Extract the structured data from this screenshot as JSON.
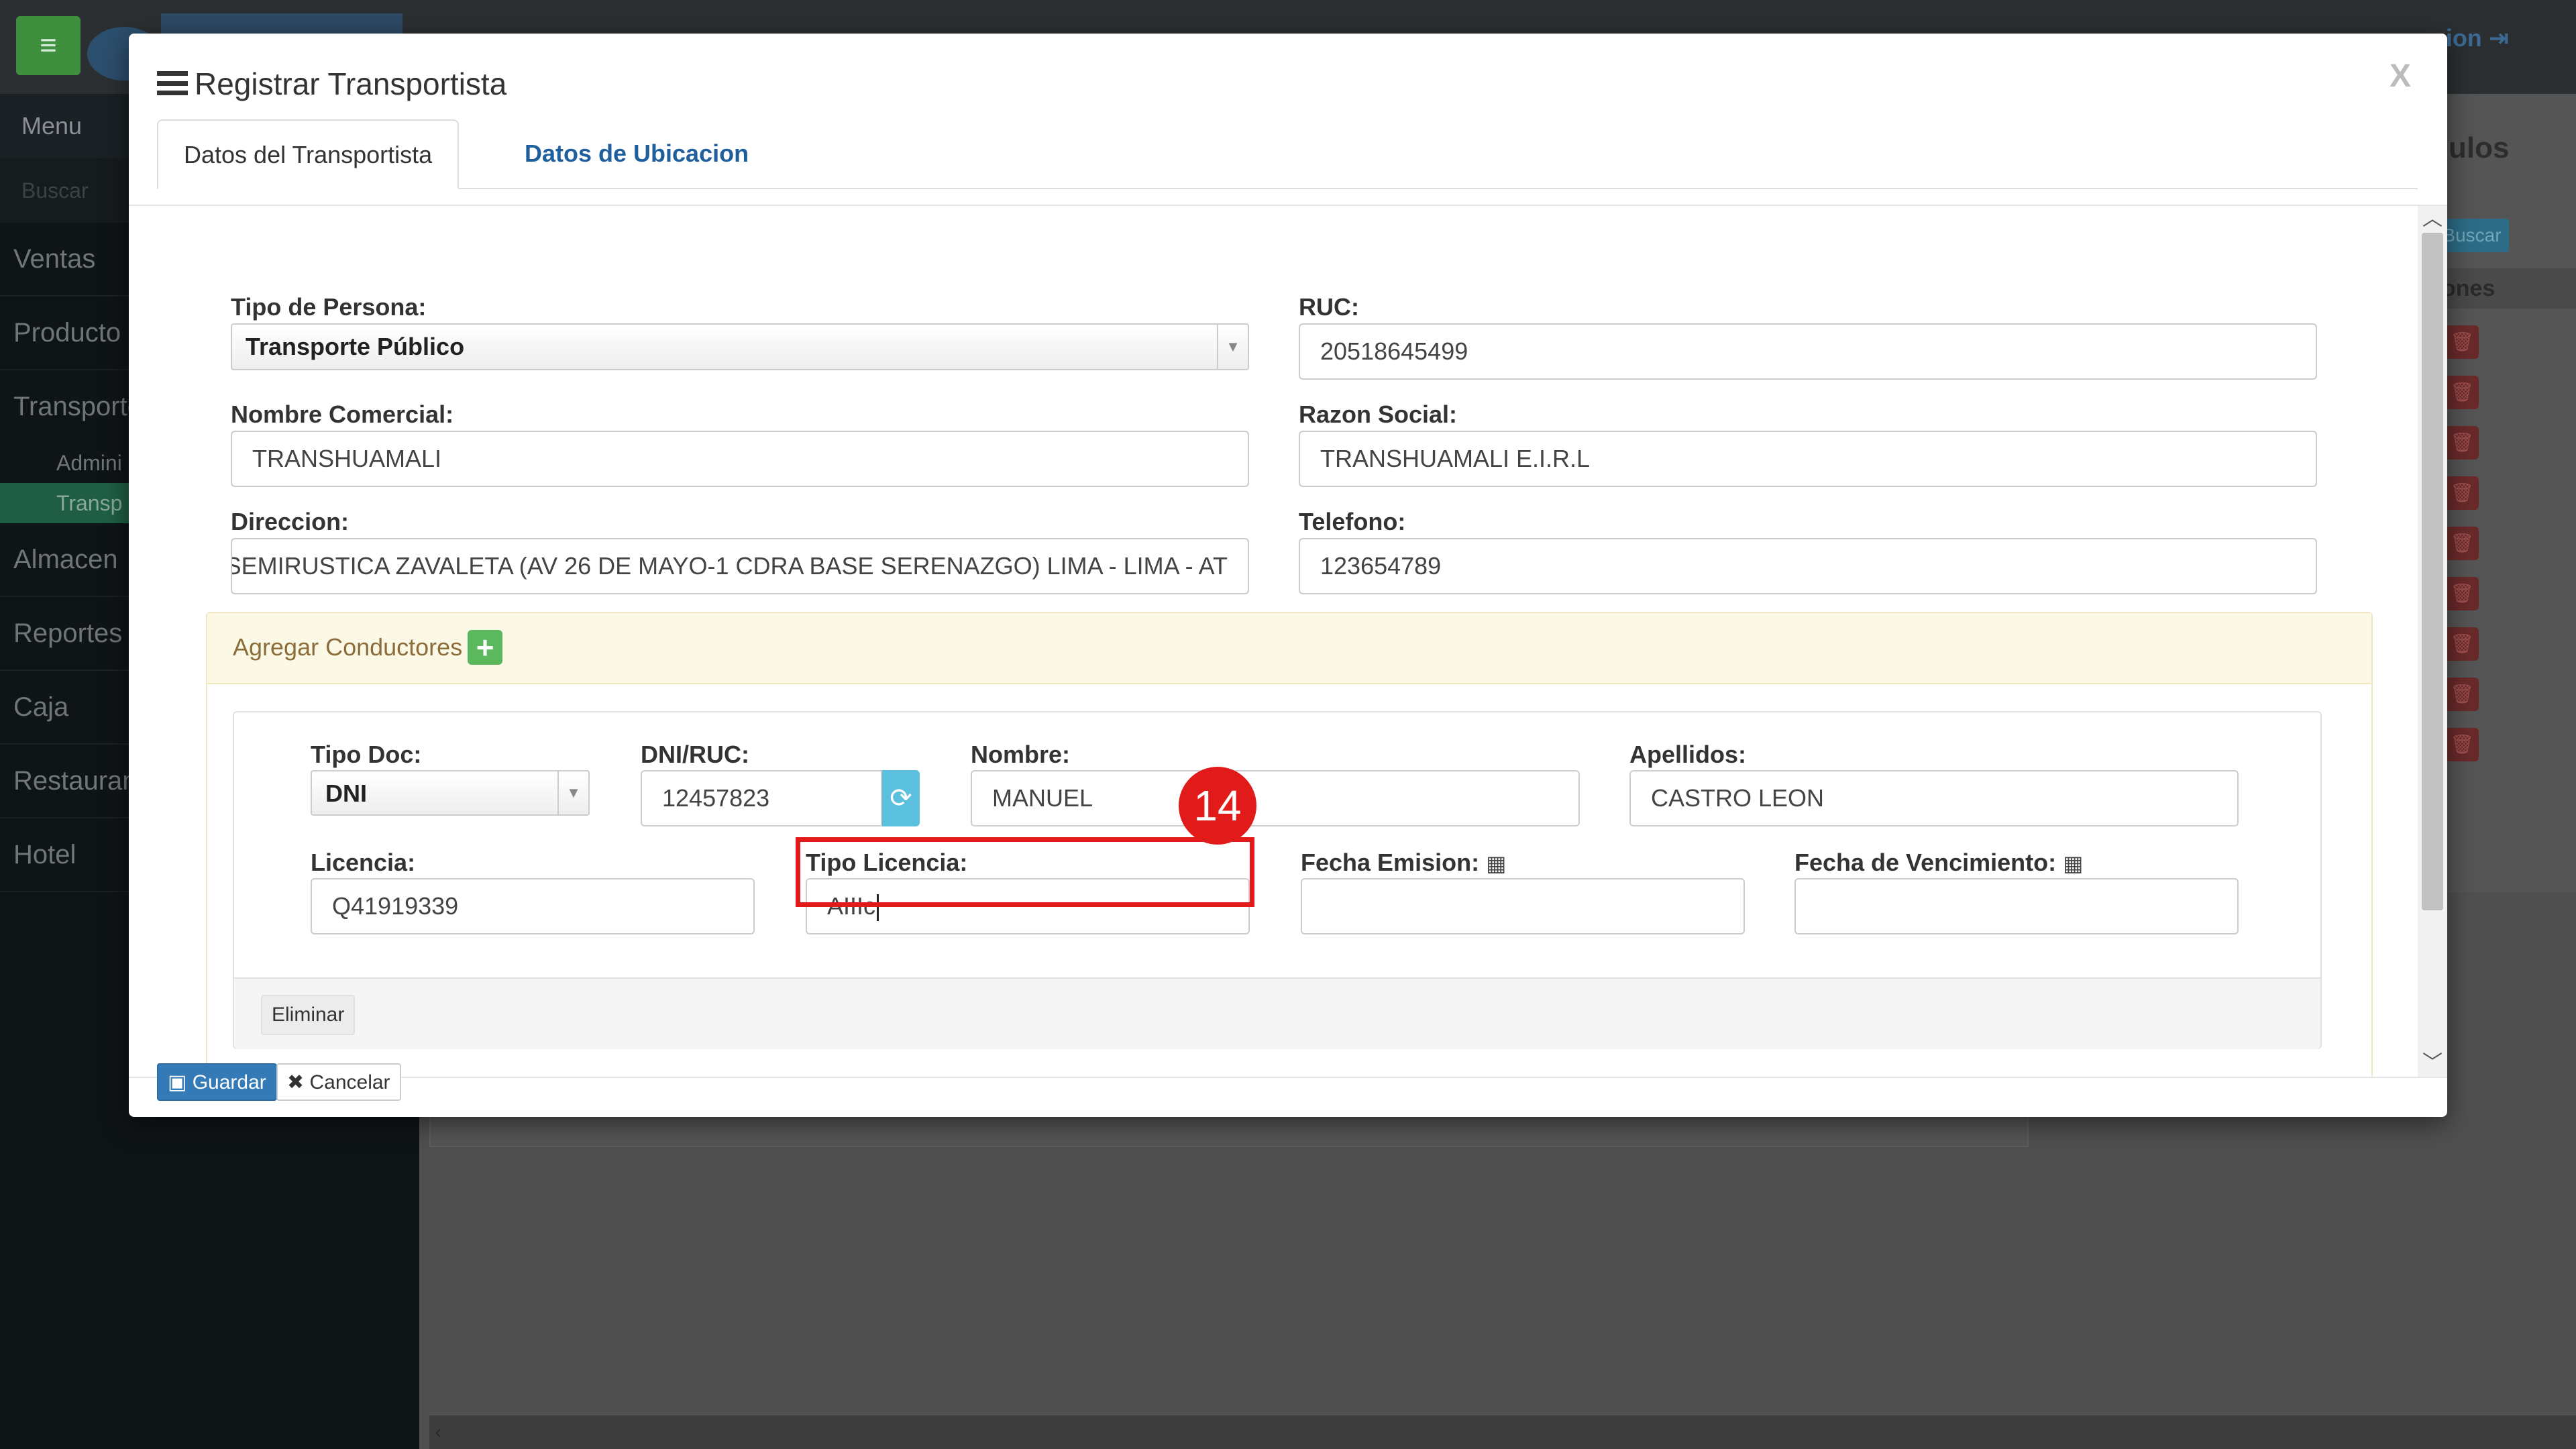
{
  "background": {
    "topbar_right": "sion",
    "sidebar": {
      "menu_label": "Menu",
      "search_placeholder": "Buscar",
      "items": [
        "Ventas",
        "Producto",
        "Transporte",
        "Almacen",
        "Reportes",
        "Caja",
        "Restaurant",
        "Hotel"
      ],
      "sub_items": [
        "Admini",
        "Transp"
      ]
    },
    "right_title": "ulos",
    "right_button": "Buscar",
    "right_header": "ones"
  },
  "modal": {
    "title": "Registrar Transportista",
    "close_label": "X",
    "tabs": [
      {
        "label": "Datos del Transportista",
        "active": true
      },
      {
        "label": "Datos de Ubicacion",
        "active": false
      }
    ],
    "fields": {
      "tipo_persona": {
        "label": "Tipo de Persona:",
        "value": "Transporte Público"
      },
      "ruc": {
        "label": "RUC:",
        "value": "20518645499"
      },
      "nombre_comercial": {
        "label": "Nombre Comercial:",
        "value": "TRANSHUAMALI"
      },
      "razon_social": {
        "label": "Razon Social:",
        "value": "TRANSHUAMALI E.I.R.L"
      },
      "direccion": {
        "label": "Direccion:",
        "value": "SEMIRUSTICA ZAVALETA (AV 26 DE MAYO-1 CDRA BASE SERENAZGO) LIMA - LIMA - AT"
      },
      "telefono": {
        "label": "Telefono:",
        "value": "123654789"
      }
    },
    "conductores": {
      "title": "Agregar Conductores",
      "add_icon": "plus-icon",
      "driver": {
        "tipo_doc": {
          "label": "Tipo Doc:",
          "value": "DNI"
        },
        "dni_ruc": {
          "label": "DNI/RUC:",
          "value": "12457823"
        },
        "nombre": {
          "label": "Nombre:",
          "value": "MANUEL"
        },
        "apellidos": {
          "label": "Apellidos:",
          "value": "CASTRO LEON"
        },
        "licencia": {
          "label": "Licencia:",
          "value": "Q41919339"
        },
        "tipo_licencia": {
          "label": "Tipo Licencia:",
          "value": "AIIIc"
        },
        "fecha_emision": {
          "label": "Fecha Emision:",
          "value": ""
        },
        "fecha_vencimiento": {
          "label": "Fecha de Vencimiento:",
          "value": ""
        },
        "delete_label": "Eliminar"
      }
    },
    "footer": {
      "save_label": "Guardar",
      "cancel_label": "Cancelar"
    },
    "annotation_badge": "14",
    "accent_colors": {
      "highlight": "#e11a1a",
      "primary": "#337ab7",
      "success": "#5cb85c",
      "info": "#5bc0de"
    }
  }
}
